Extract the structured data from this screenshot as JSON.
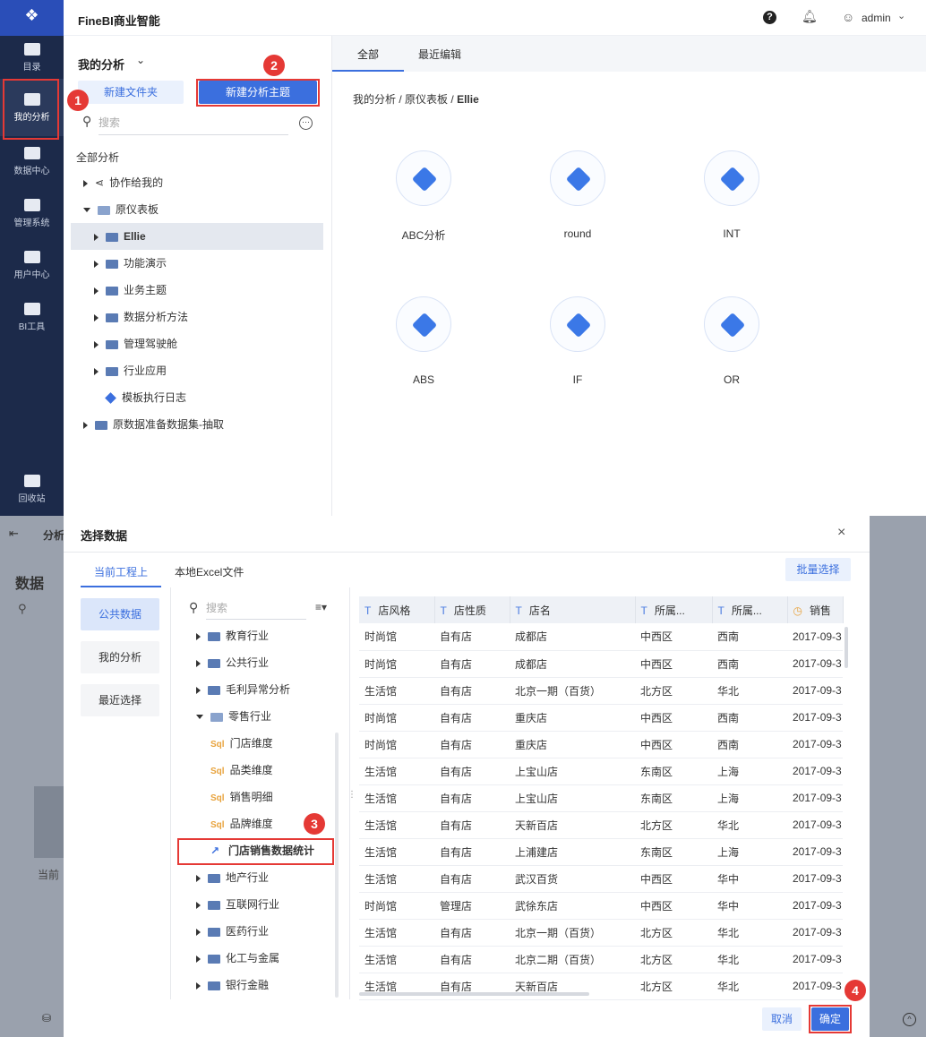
{
  "app": {
    "title": "FineBI商业智能",
    "user": "admin"
  },
  "nav": {
    "items": [
      {
        "label": "目录"
      },
      {
        "label": "我的分析"
      },
      {
        "label": "数据中心"
      },
      {
        "label": "管理系统"
      },
      {
        "label": "用户中心"
      },
      {
        "label": "BI工具"
      },
      {
        "label": "回收站"
      }
    ]
  },
  "panel": {
    "title": "我的分析",
    "new_folder": "新建文件夹",
    "new_topic": "新建分析主题",
    "search_placeholder": "搜索",
    "all_label": "全部分析",
    "tree": [
      {
        "label": "协作给我的"
      },
      {
        "label": "原仪表板"
      },
      {
        "label": "Ellie"
      },
      {
        "label": "功能演示"
      },
      {
        "label": "业务主题"
      },
      {
        "label": "数据分析方法"
      },
      {
        "label": "管理驾驶舱"
      },
      {
        "label": "行业应用"
      },
      {
        "label": "模板执行日志"
      },
      {
        "label": "原数据准备数据集-抽取"
      }
    ]
  },
  "content": {
    "tabs": [
      "全部",
      "最近编辑"
    ],
    "breadcrumb": [
      "我的分析",
      "原仪表板",
      "Ellie"
    ],
    "cards": [
      "ABC分析",
      "round",
      "INT",
      "ABS",
      "IF",
      "OR"
    ]
  },
  "badges": [
    "1",
    "2",
    "3",
    "4"
  ],
  "background": {
    "analysis_tab": "分析",
    "data_label": "数据",
    "current_label": "当前"
  },
  "dialog": {
    "title": "选择数据",
    "tabs": [
      "当前工程上",
      "本地Excel文件"
    ],
    "batch_select": "批量选择",
    "search_placeholder": "搜索",
    "left_nav": [
      "公共数据",
      "我的分析",
      "最近选择"
    ],
    "tree": [
      "教育行业",
      "公共行业",
      "毛利异常分析",
      "零售行业",
      "门店维度",
      "品类维度",
      "销售明细",
      "品牌维度",
      "门店销售数据统计",
      "地产行业",
      "互联网行业",
      "医药行业",
      "化工与金属",
      "银行金融"
    ],
    "columns": [
      "店风格",
      "店性质",
      "店名",
      "所属...",
      "所属...",
      "销售"
    ],
    "rows": [
      [
        "时尚馆",
        "自有店",
        "成都店",
        "中西区",
        "西南",
        "2017-09-3"
      ],
      [
        "时尚馆",
        "自有店",
        "成都店",
        "中西区",
        "西南",
        "2017-09-3"
      ],
      [
        "生活馆",
        "自有店",
        "北京一期（百货）",
        "北方区",
        "华北",
        "2017-09-3"
      ],
      [
        "时尚馆",
        "自有店",
        "重庆店",
        "中西区",
        "西南",
        "2017-09-3"
      ],
      [
        "时尚馆",
        "自有店",
        "重庆店",
        "中西区",
        "西南",
        "2017-09-3"
      ],
      [
        "生活馆",
        "自有店",
        "上宝山店",
        "东南区",
        "上海",
        "2017-09-3"
      ],
      [
        "生活馆",
        "自有店",
        "上宝山店",
        "东南区",
        "上海",
        "2017-09-3"
      ],
      [
        "生活馆",
        "自有店",
        "天新百店",
        "北方区",
        "华北",
        "2017-09-3"
      ],
      [
        "生活馆",
        "自有店",
        "上浦建店",
        "东南区",
        "上海",
        "2017-09-3"
      ],
      [
        "生活馆",
        "自有店",
        "武汉百货",
        "中西区",
        "华中",
        "2017-09-3"
      ],
      [
        "时尚馆",
        "管理店",
        "武徐东店",
        "中西区",
        "华中",
        "2017-09-3"
      ],
      [
        "生活馆",
        "自有店",
        "北京一期（百货）",
        "北方区",
        "华北",
        "2017-09-3"
      ],
      [
        "生活馆",
        "自有店",
        "北京二期（百货）",
        "北方区",
        "华北",
        "2017-09-3"
      ],
      [
        "生活馆",
        "自有店",
        "天新百店",
        "北方区",
        "华北",
        "2017-09-3"
      ]
    ],
    "cancel": "取消",
    "confirm": "确定"
  }
}
